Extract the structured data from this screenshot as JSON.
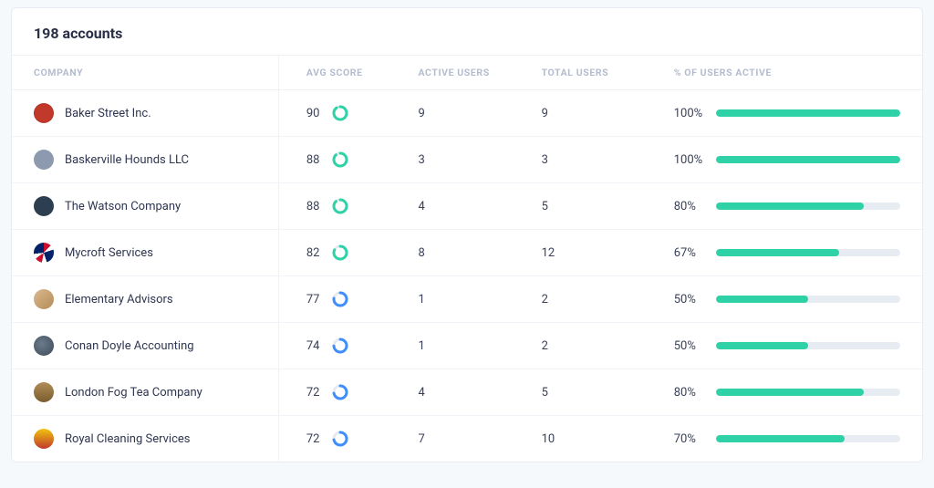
{
  "title": "198 accounts",
  "columns": {
    "company": "COMPANY",
    "avg_score": "AVG SCORE",
    "active_users": "ACTIVE USERS",
    "total_users": "TOTAL USERS",
    "pct_active": "% OF USERS ACTIVE"
  },
  "colors": {
    "score_high": "#2fd1a6",
    "score_mid": "#3f8efc",
    "bar_fill": "#2fd1a6",
    "bar_track": "#e7ecf2"
  },
  "rows": [
    {
      "company": "Baker Street Inc.",
      "avatar_class": "av-red",
      "avg_score": 90,
      "active_users": 9,
      "total_users": 9,
      "pct_active": 100,
      "pct_label": "100%"
    },
    {
      "company": "Baskerville Hounds LLC",
      "avatar_class": "av-grey",
      "avg_score": 88,
      "active_users": 3,
      "total_users": 3,
      "pct_active": 100,
      "pct_label": "100%"
    },
    {
      "company": "The Watson Company",
      "avatar_class": "av-dark",
      "avg_score": 88,
      "active_users": 4,
      "total_users": 5,
      "pct_active": 80,
      "pct_label": "80%"
    },
    {
      "company": "Mycroft Services",
      "avatar_class": "av-uk",
      "avg_score": 82,
      "active_users": 8,
      "total_users": 12,
      "pct_active": 67,
      "pct_label": "67%"
    },
    {
      "company": "Elementary Advisors",
      "avatar_class": "av-book",
      "avg_score": 77,
      "active_users": 1,
      "total_users": 2,
      "pct_active": 50,
      "pct_label": "50%"
    },
    {
      "company": "Conan Doyle Accounting",
      "avatar_class": "av-globe",
      "avg_score": 74,
      "active_users": 1,
      "total_users": 2,
      "pct_active": 50,
      "pct_label": "50%"
    },
    {
      "company": "London Fog Tea Company",
      "avatar_class": "av-bigben",
      "avg_score": 72,
      "active_users": 4,
      "total_users": 5,
      "pct_active": 80,
      "pct_label": "80%"
    },
    {
      "company": "Royal Cleaning Services",
      "avatar_class": "av-crown",
      "avg_score": 72,
      "active_users": 7,
      "total_users": 10,
      "pct_active": 70,
      "pct_label": "70%"
    }
  ]
}
